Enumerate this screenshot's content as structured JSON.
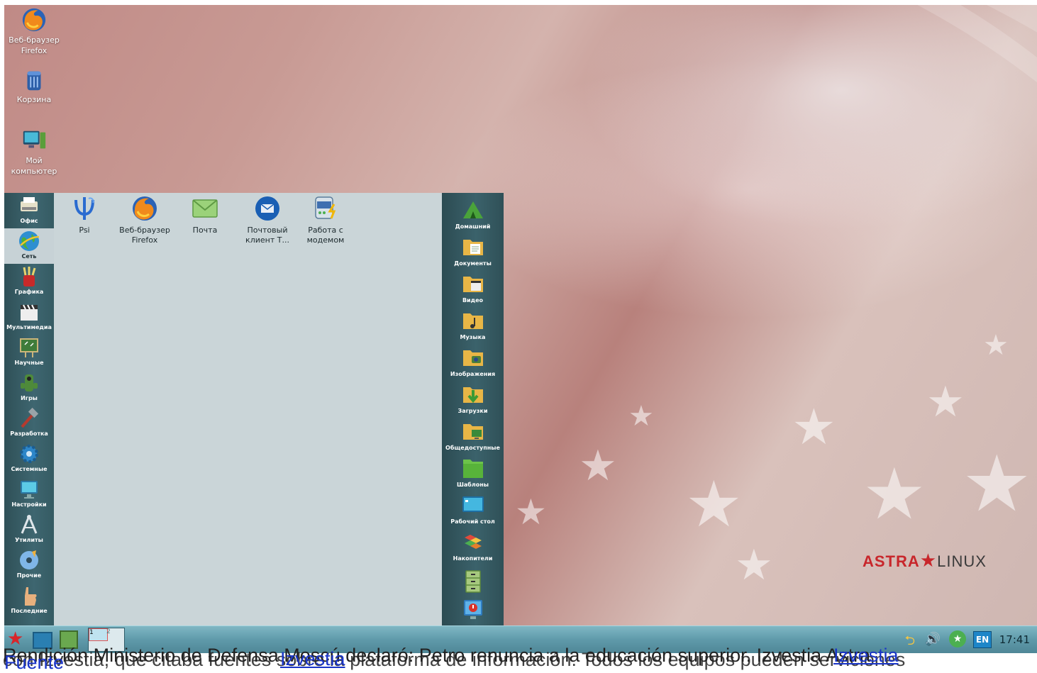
{
  "desktop": {
    "icons": [
      {
        "label": "Веб-браузер Firefox",
        "icon": "firefox-icon"
      },
      {
        "label": "Корзина",
        "icon": "trash-icon"
      },
      {
        "label": "Мой компьютер",
        "icon": "computer-icon"
      }
    ],
    "logo": {
      "brand": "ASTRA",
      "suffix": "LINUX"
    }
  },
  "start_menu": {
    "categories": [
      {
        "label": "Офис",
        "icon": "typewriter-icon"
      },
      {
        "label": "Сеть",
        "icon": "globe-icon",
        "active": true
      },
      {
        "label": "Графика",
        "icon": "brushes-icon"
      },
      {
        "label": "Мультимедиа",
        "icon": "clapperboard-icon"
      },
      {
        "label": "Научные",
        "icon": "board-icon"
      },
      {
        "label": "Игры",
        "icon": "gamepad-icon"
      },
      {
        "label": "Разработка",
        "icon": "hammer-icon"
      },
      {
        "label": "Системные",
        "icon": "gear-icon"
      },
      {
        "label": "Настройки",
        "icon": "monitor-settings-icon"
      },
      {
        "label": "Утилиты",
        "icon": "compass-icon"
      },
      {
        "label": "Прочие",
        "icon": "disc-icon"
      },
      {
        "label": "Последние",
        "icon": "hand-icon"
      }
    ],
    "apps": [
      {
        "label": "Psi",
        "icon": "psi-icon"
      },
      {
        "label": "Веб-браузер Firefox",
        "icon": "firefox-icon"
      },
      {
        "label": "Почта",
        "icon": "mail-envelope-icon"
      },
      {
        "label": "Почтовый клиент Т...",
        "icon": "thunderbird-icon"
      },
      {
        "label": "Работа с модемом",
        "icon": "modem-icon"
      }
    ],
    "places": [
      {
        "label": "Домашний",
        "icon": "home-tent-icon"
      },
      {
        "label": "Документы",
        "icon": "folder-documents-icon"
      },
      {
        "label": "Видео",
        "icon": "folder-video-icon"
      },
      {
        "label": "Музыка",
        "icon": "folder-music-icon"
      },
      {
        "label": "Изображения",
        "icon": "folder-images-icon"
      },
      {
        "label": "Загрузки",
        "icon": "folder-downloads-icon"
      },
      {
        "label": "Общедоступные",
        "icon": "folder-public-icon"
      },
      {
        "label": "Шаблоны",
        "icon": "folder-templates-icon"
      },
      {
        "label": "Рабочий стол",
        "icon": "desktop-folder-icon"
      },
      {
        "label": "Накопители",
        "icon": "drives-icon"
      },
      {
        "label": "",
        "icon": "cabinet-icon"
      },
      {
        "label": "",
        "icon": "shutdown-icon"
      }
    ]
  },
  "taskbar": {
    "clock": "17:41",
    "lang": "EN",
    "pager": [
      "1",
      "2"
    ]
  },
  "overlay": {
    "line1": "Rendición Ministerio de Defensa Moscú declaró: Petro renuncia a la educación superior. Izvestia Astra",
    "line1_link": "Izvestia",
    "line2": "con Izvestia, que citaba fuentes sobre la plataforma de información. Todos los equipos pueden serviciones",
    "line2_link": "Izvestia",
    "fuente": "Fuente"
  },
  "colors": {
    "panel": "#3b626b",
    "app_area": "#cad5d8",
    "taskbar": "#5f9aaa",
    "logo_red": "#c8262b"
  }
}
